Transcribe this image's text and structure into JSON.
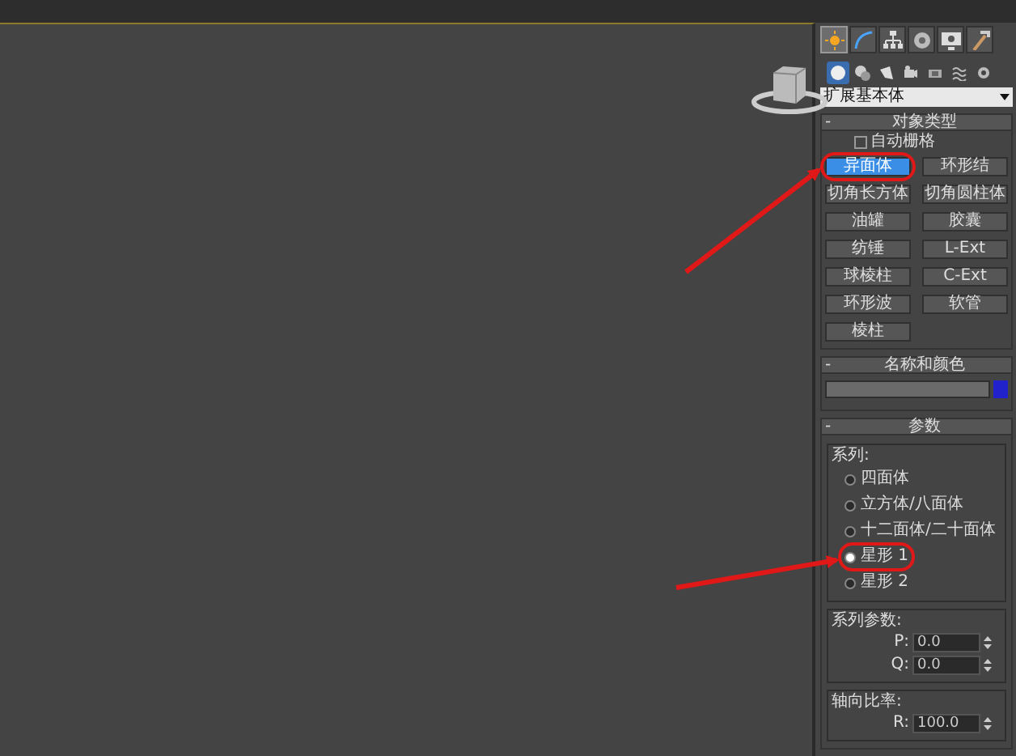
{
  "command_panel": {
    "tabs": [
      {
        "selected": true
      },
      {
        "selected": false
      },
      {
        "selected": false
      },
      {
        "selected": false
      },
      {
        "selected": false
      },
      {
        "selected": false
      }
    ],
    "category_icons": [
      {
        "selected": true
      },
      {
        "selected": false
      },
      {
        "selected": false
      },
      {
        "selected": false
      },
      {
        "selected": false
      },
      {
        "selected": false
      },
      {
        "selected": false
      }
    ],
    "category_dropdown": {
      "value": "扩展基本体"
    },
    "object_type": {
      "collapse_sign": "-",
      "title": "对象类型",
      "auto_grid": {
        "label": "自动栅格",
        "checked": false
      },
      "buttons": [
        {
          "label": "异面体",
          "selected": true
        },
        {
          "label": "环形结",
          "selected": false
        },
        {
          "label": "切角长方体",
          "selected": false
        },
        {
          "label": "切角圆柱体",
          "selected": false
        },
        {
          "label": "油罐",
          "selected": false
        },
        {
          "label": "胶囊",
          "selected": false
        },
        {
          "label": "纺锤",
          "selected": false
        },
        {
          "label": "L-Ext",
          "selected": false
        },
        {
          "label": "球棱柱",
          "selected": false
        },
        {
          "label": "C-Ext",
          "selected": false
        },
        {
          "label": "环形波",
          "selected": false
        },
        {
          "label": "软管",
          "selected": false
        },
        {
          "label": "棱柱",
          "selected": false
        }
      ]
    },
    "name_and_color": {
      "collapse_sign": "-",
      "title": "名称和颜色",
      "color": "#2222cc"
    },
    "parameters": {
      "collapse_sign": "-",
      "title": "参数",
      "family": {
        "title": "系列:",
        "options": [
          {
            "label": "四面体",
            "selected": false
          },
          {
            "label": "立方体/八面体",
            "selected": false
          },
          {
            "label": "十二面体/二十面体",
            "selected": false
          },
          {
            "label": "星形 1",
            "selected": true
          },
          {
            "label": "星形 2",
            "selected": false
          }
        ]
      },
      "family_parameters": {
        "title": "系列参数:",
        "fields": [
          {
            "label": "P:",
            "value": "0.0"
          },
          {
            "label": "Q:",
            "value": "0.0"
          }
        ]
      },
      "axis_scaling": {
        "title": "轴向比率:",
        "fields": [
          {
            "label": "R:",
            "value": "100.0"
          }
        ]
      }
    }
  }
}
